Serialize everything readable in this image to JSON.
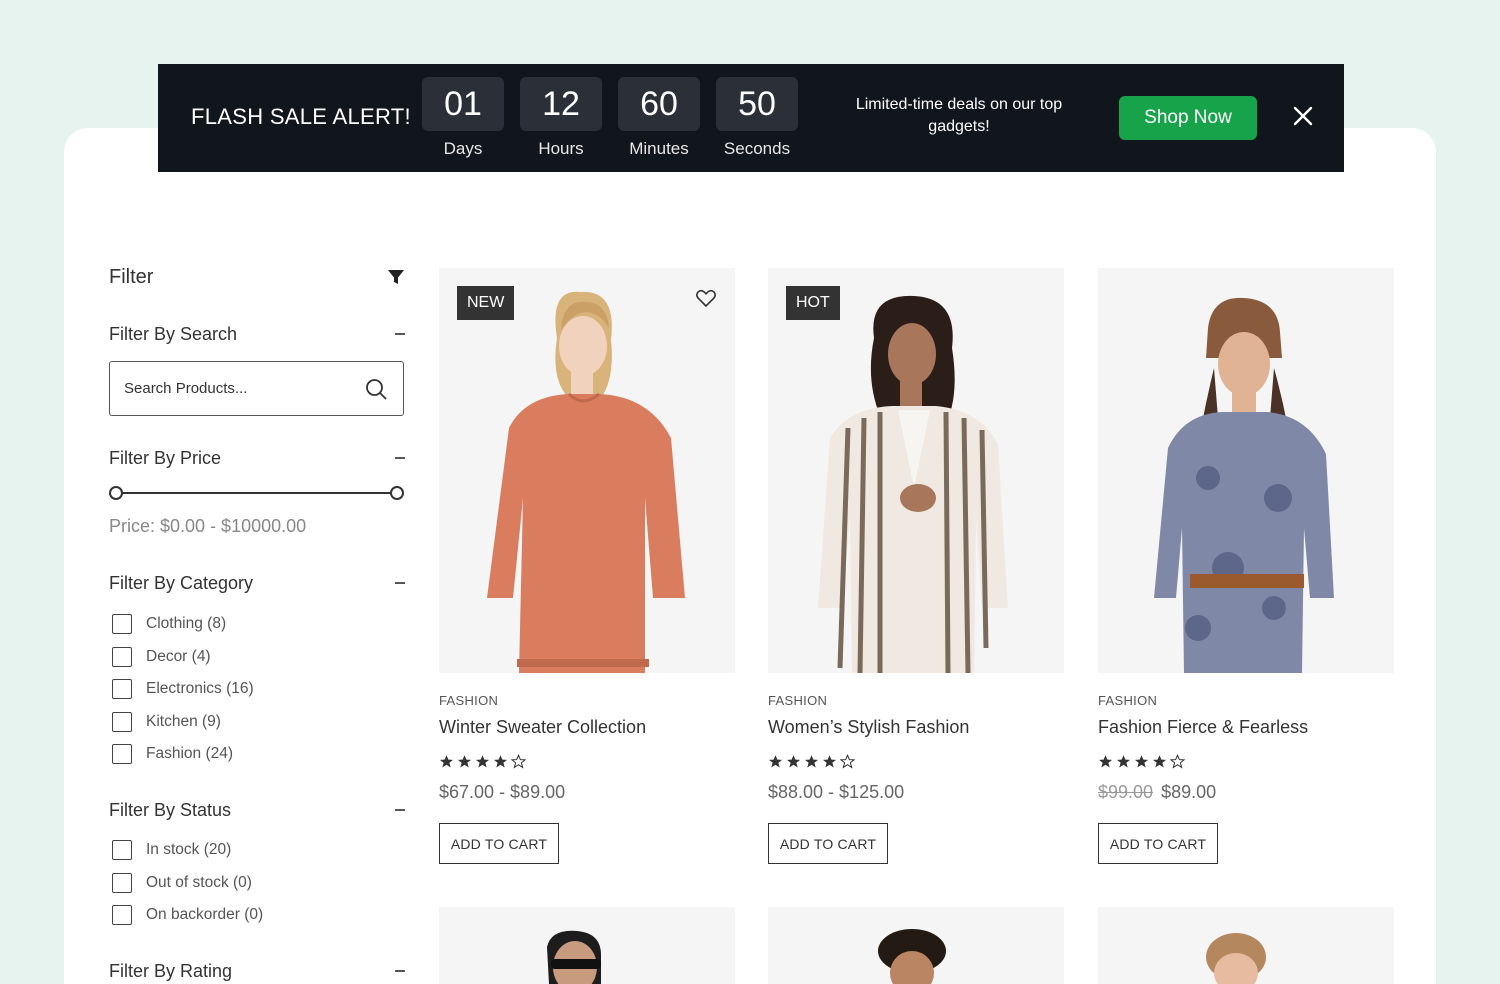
{
  "banner": {
    "title": "FLASH SALE ALERT!",
    "countdown": [
      {
        "value": "01",
        "label": "Days"
      },
      {
        "value": "12",
        "label": "Hours"
      },
      {
        "value": "60",
        "label": "Minutes"
      },
      {
        "value": "50",
        "label": "Seconds"
      }
    ],
    "message": "Limited-time deals on our top gadgets!",
    "cta": "Shop Now",
    "close_icon": "close-icon",
    "cta_color": "#16a34a"
  },
  "sidebar": {
    "title": "Filter",
    "filter_icon": "funnel-icon",
    "search_section": "Filter By Search",
    "search_placeholder": "Search Products...",
    "price_section": "Filter By Price",
    "price_range": {
      "min": 0,
      "max": 10000
    },
    "price_text": "Price: $0.00 - $10000.00",
    "category_section": "Filter By Category",
    "categories": [
      "Clothing (8)",
      "Decor (4)",
      "Electronics (16)",
      "Kitchen (9)",
      "Fashion (24)"
    ],
    "status_section": "Filter By Status",
    "statuses": [
      "In stock (20)",
      "Out of stock (0)",
      "On backorder (0)"
    ],
    "rating_section": "Filter By Rating"
  },
  "products": [
    {
      "badge": "NEW",
      "category": "FASHION",
      "name": "Winter Sweater Collection",
      "rating": 4,
      "price": "$67.00 - $89.00",
      "old_price": "",
      "cart": "ADD TO CART"
    },
    {
      "badge": "HOT",
      "category": "FASHION",
      "name": "Women’s Stylish Fashion",
      "rating": 4,
      "price": "$88.00 - $125.00",
      "old_price": "",
      "cart": "ADD TO CART"
    },
    {
      "badge": "",
      "category": "FASHION",
      "name": "Fashion Fierce & Fearless",
      "rating": 4,
      "price": "$89.00",
      "old_price": "$99.00",
      "cart": "ADD TO CART"
    }
  ],
  "colors": {
    "background": "#e6f3ee",
    "banner": "#11151c",
    "text": "#333333"
  }
}
